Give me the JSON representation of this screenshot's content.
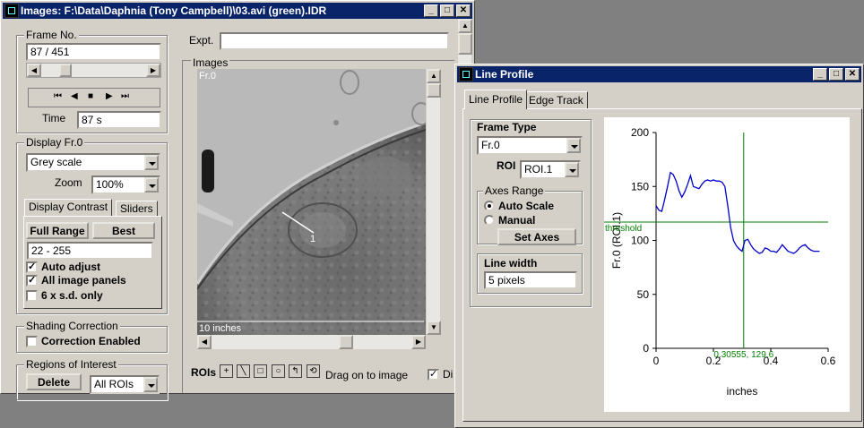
{
  "images_window": {
    "title": "Images: F:\\Data\\Daphnia (Tony Campbell)\\03.avi (green).IDR",
    "frame_no": {
      "label": "Frame No.",
      "value": "87 / 451",
      "slider_position_fraction": 0.19
    },
    "playback_buttons": [
      "first-frame",
      "previous-frame",
      "stop",
      "next-frame",
      "last-frame"
    ],
    "time": {
      "label": "Time",
      "value": "87 s"
    },
    "display": {
      "group_label": "Display Fr.0",
      "mode": "Grey scale",
      "zoom_label": "Zoom",
      "zoom_value": "100%"
    },
    "contrast_tabs": [
      "Display Contrast",
      "Sliders"
    ],
    "full_range_label": "Full Range",
    "best_label": "Best",
    "range_value": "22 - 255",
    "auto_adjust": "Auto adjust",
    "all_image_panels": "All image panels",
    "six_sd_only": "6 x s.d. only",
    "shading": {
      "group_label": "Shading Correction",
      "enabled_label": "Correction Enabled"
    },
    "roi_group": {
      "group_label": "Regions of Interest",
      "delete_label": "Delete",
      "select_value": "All ROIs"
    },
    "expt_label": "Expt.",
    "expt_value": "",
    "images_group_label": "Images",
    "frame_overlay": "Fr.0",
    "roi_marker_label": "1",
    "scale_bar_label": "10 inches",
    "rois_label": "ROIs",
    "drag_hint": "Drag on to image",
    "checkbox_cut_label": "Di"
  },
  "line_profile_window": {
    "title": "Line Profile",
    "tabs": [
      "Line Profile",
      "Edge Track"
    ],
    "frame_type": {
      "label": "Frame Type",
      "value": "Fr.0"
    },
    "roi": {
      "label": "ROI",
      "value": "ROI.1"
    },
    "axes_range": {
      "group_label": "Axes Range",
      "auto_label": "Auto Scale",
      "manual_label": "Manual",
      "set_axes_label": "Set Axes",
      "selected": "auto"
    },
    "line_width": {
      "label": "Line width",
      "value": "5 pixels"
    }
  },
  "chart_data": {
    "type": "line",
    "xlabel": "inches",
    "ylabel": "Fr.0 (ROI.1)",
    "xlim": [
      0,
      0.6
    ],
    "ylim": [
      0,
      200
    ],
    "xticks": [
      "0",
      "0.2",
      "0.4",
      "0.6"
    ],
    "yticks": [
      "0",
      "50",
      "100",
      "150",
      "200"
    ],
    "line_color": "#0000c8",
    "cursor_color": "#008000",
    "threshold_label": "threshold",
    "threshold_value": 117,
    "cursor_x": 0.30555,
    "cursor_readout": "0.30555, 129.6",
    "series": [
      {
        "x": [
          0,
          0.01,
          0.02,
          0.03,
          0.04,
          0.05,
          0.06,
          0.07,
          0.08,
          0.09,
          0.1,
          0.11,
          0.12,
          0.13,
          0.14,
          0.15,
          0.16,
          0.17,
          0.18,
          0.19,
          0.2,
          0.21,
          0.22,
          0.23,
          0.24,
          0.25,
          0.26,
          0.27,
          0.28,
          0.29,
          0.3,
          0.31,
          0.32,
          0.33,
          0.34,
          0.35,
          0.36,
          0.37,
          0.38,
          0.39,
          0.4,
          0.41,
          0.42,
          0.43,
          0.44,
          0.45,
          0.46,
          0.47,
          0.48,
          0.49,
          0.5,
          0.51,
          0.52,
          0.53,
          0.54,
          0.55,
          0.56,
          0.57
        ],
        "values": [
          132,
          128,
          127,
          138,
          150,
          163,
          161,
          155,
          146,
          140,
          145,
          152,
          160,
          150,
          149,
          148,
          152,
          155,
          156,
          155,
          156,
          155,
          155,
          154,
          150,
          132,
          112,
          100,
          95,
          92,
          90,
          100,
          101,
          96,
          92,
          90,
          88,
          89,
          93,
          92,
          90,
          90,
          89,
          92,
          96,
          93,
          90,
          89,
          88,
          90,
          93,
          95,
          96,
          93,
          91,
          90,
          90,
          90
        ]
      }
    ]
  }
}
